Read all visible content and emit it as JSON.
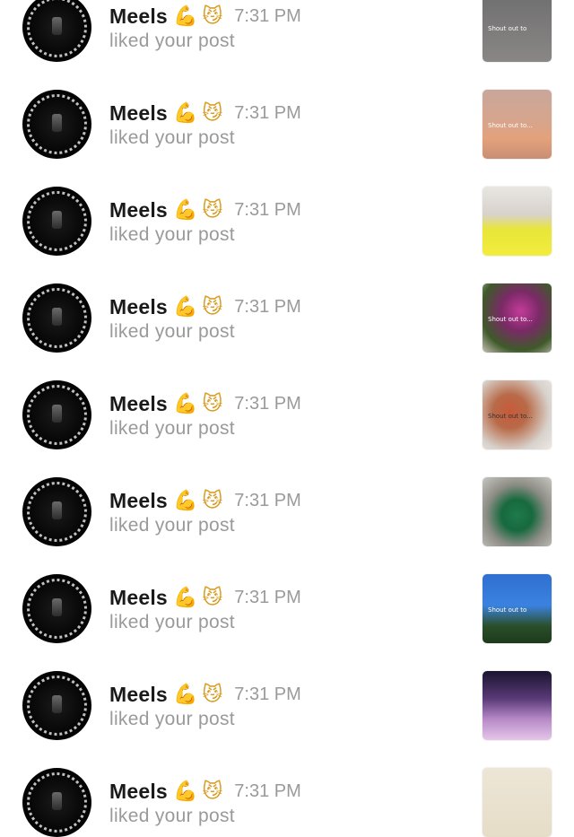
{
  "notifications": [
    {
      "name": "Meels",
      "emoji1": "💪",
      "emoji2": "😼",
      "time": "7:31 PM",
      "action": "liked your post",
      "thumb_caption": "Shout out to"
    },
    {
      "name": "Meels",
      "emoji1": "💪",
      "emoji2": "😼",
      "time": "7:31 PM",
      "action": "liked your post",
      "thumb_caption": "Shout out to..."
    },
    {
      "name": "Meels",
      "emoji1": "💪",
      "emoji2": "😼",
      "time": "7:31 PM",
      "action": "liked your post",
      "thumb_caption": ""
    },
    {
      "name": "Meels",
      "emoji1": "💪",
      "emoji2": "😼",
      "time": "7:31 PM",
      "action": "liked your post",
      "thumb_caption": "Shout out to..."
    },
    {
      "name": "Meels",
      "emoji1": "💪",
      "emoji2": "😼",
      "time": "7:31 PM",
      "action": "liked your post",
      "thumb_caption": "Shout out to..."
    },
    {
      "name": "Meels",
      "emoji1": "💪",
      "emoji2": "😼",
      "time": "7:31 PM",
      "action": "liked your post",
      "thumb_caption": ""
    },
    {
      "name": "Meels",
      "emoji1": "💪",
      "emoji2": "😼",
      "time": "7:31 PM",
      "action": "liked your post",
      "thumb_caption": "Shout out to"
    },
    {
      "name": "Meels",
      "emoji1": "💪",
      "emoji2": "😼",
      "time": "7:31 PM",
      "action": "liked your post",
      "thumb_caption": ""
    },
    {
      "name": "Meels",
      "emoji1": "💪",
      "emoji2": "😼",
      "time": "7:31 PM",
      "action": "liked your post",
      "thumb_caption": ""
    }
  ]
}
